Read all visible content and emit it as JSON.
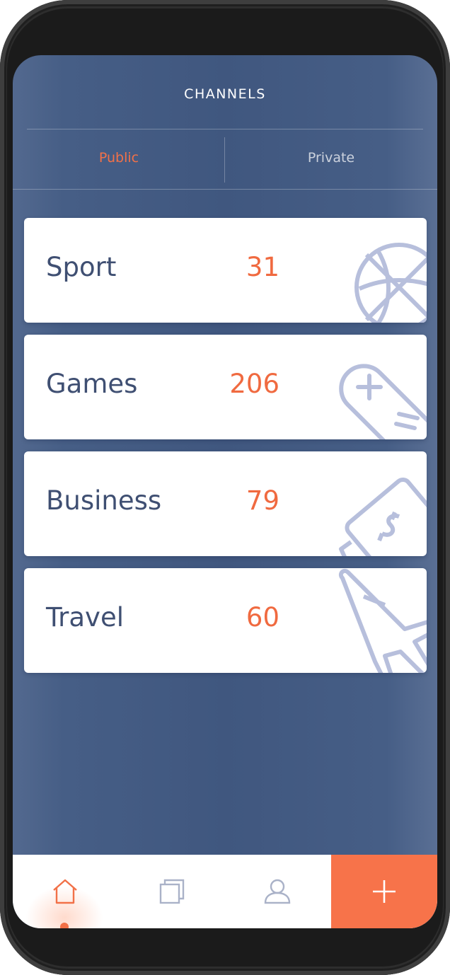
{
  "header": {
    "title": "CHANNELS"
  },
  "tabs": [
    {
      "label": "Public",
      "active": true
    },
    {
      "label": "Private",
      "active": false
    }
  ],
  "channels": [
    {
      "name": "Sport",
      "count": "31",
      "icon": "basketball-icon"
    },
    {
      "name": "Games",
      "count": "206",
      "icon": "gamepad-icon"
    },
    {
      "name": "Business",
      "count": "79",
      "icon": "money-icon"
    },
    {
      "name": "Travel",
      "count": "60",
      "icon": "airplane-icon"
    }
  ],
  "bottom_nav": {
    "items": [
      {
        "icon": "home-icon",
        "active": true
      },
      {
        "icon": "copy-icon",
        "active": false
      },
      {
        "icon": "user-icon",
        "active": false
      }
    ],
    "add_icon": "plus-icon"
  },
  "colors": {
    "background": "#40577f",
    "accent": "#f27148",
    "card": "#ffffff",
    "card_text": "#3f4f72",
    "icon_lavender": "#b7bfdc"
  }
}
